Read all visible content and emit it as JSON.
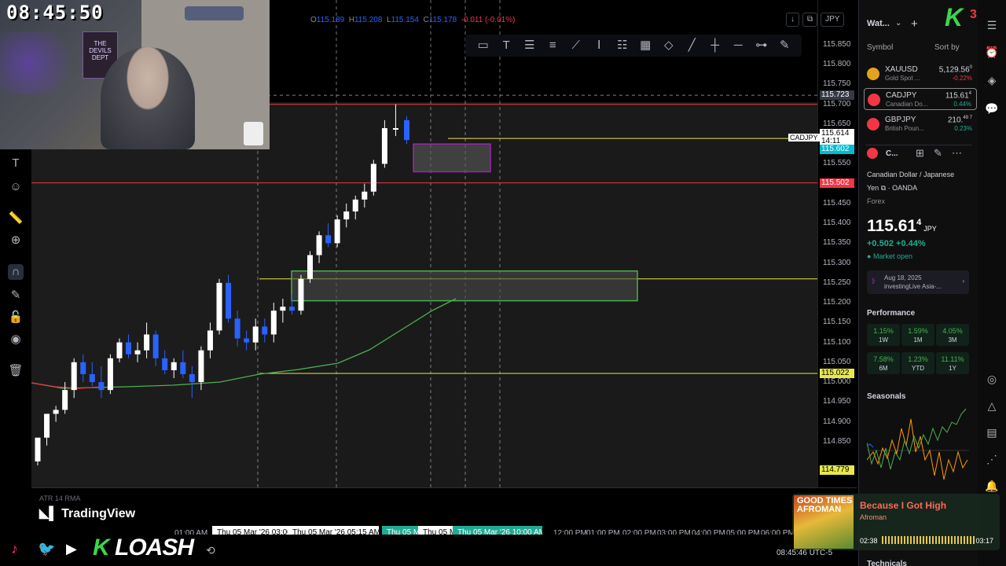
{
  "overlay": {
    "clock": "08:45:50",
    "poster_text": "THE DEVILS DEPT"
  },
  "chart": {
    "symbol": "CADJPY",
    "ohlc": {
      "o_label": "O",
      "o": "115.189",
      "h_label": "H",
      "h": "115.208",
      "l_label": "L",
      "l": "115.154",
      "c_label": "C",
      "c": "115.178",
      "change": "-0.011 (-0.01%)"
    },
    "currency_button": "JPY",
    "price_ticks": [
      "115.850",
      "115.800",
      "115.750",
      "115.700",
      "115.650",
      "115.600",
      "115.550",
      "115.450",
      "115.400",
      "115.350",
      "115.300",
      "115.250",
      "115.200",
      "115.150",
      "115.100",
      "115.050",
      "115.000",
      "114.950",
      "114.900",
      "114.850"
    ],
    "price_tags": {
      "crosshair": "115.723",
      "symbol_tag": "CADJPY",
      "last": "115.614",
      "countdown": "14:11",
      "bid": "115.602",
      "red_line": "115.502",
      "yellow_line": "115.022",
      "bottom": "114.779"
    },
    "atr_label": "ATR 14 RMA",
    "brand": "TradingView",
    "time_labels": [
      "01:00 AM",
      "12:00 PM",
      "01:00 PM",
      "02:00 PM",
      "03:00 PM",
      "04:00 PM",
      "05:00 PM",
      "06:00 PM"
    ],
    "time_pills": [
      {
        "text": "Thu 05 Mar '26   03:00",
        "color": "#ffffff",
        "bg": "#ffffff"
      },
      {
        "text": "Thu 05 Mar '26   05:15 AM",
        "color": "#ffffff",
        "bg": "#ffffff"
      },
      {
        "text": "Thu 05 M",
        "color": "#22ab94",
        "bg": "#22ab94"
      },
      {
        "text": "Thu 05 M",
        "color": "#ffffff",
        "bg": "#ffffff"
      },
      {
        "text": "Thu 05 Mar '26   10:00 AM",
        "color": "#22ab94",
        "bg": "#22ab94"
      }
    ],
    "colors": {
      "up": "#ffffff",
      "down": "#2962ff",
      "ma": "#4caf50",
      "ma_red": "#f23645",
      "zone_green": "#4caf50",
      "zone_purple": "#9c27b0",
      "level_yellow": "#e8e84a",
      "level_red": "#f23645"
    }
  },
  "left_tools": [
    "crosshair-icon",
    "text-icon",
    "smile-icon",
    "ruler-icon",
    "zoom-icon",
    "magnet-icon",
    "pencil-icon",
    "lock-icon",
    "eye-icon",
    "trash-icon"
  ],
  "draw_tools": [
    "rectangle-icon",
    "text-icon",
    "fib-icon",
    "levels-icon",
    "brush-icon",
    "text-cursor-icon",
    "lines-icon",
    "grid-icon",
    "shape-icon",
    "trendline-icon",
    "vertical-line-icon",
    "horizontal-line-icon",
    "ray-icon",
    "pen-icon"
  ],
  "watchlist": {
    "title": "Wat...",
    "col_symbol": "Symbol",
    "col_sort": "Sort by",
    "rows": [
      {
        "sym": "XAUUSD",
        "desc": "Gold Spot ...",
        "price": "5,129.56",
        "sup": "0",
        "chg": "-0.22%",
        "chg_color": "#f23645",
        "icon_color": "#e5a21b"
      },
      {
        "sym": "CADJPY",
        "desc": "Canadian Do...",
        "price": "115.61",
        "sup": "4",
        "chg": "0.44%",
        "chg_color": "#22ab94",
        "icon_color": "#f23645"
      },
      {
        "sym": "GBPJPY",
        "desc": "British Poun...",
        "price": "210.",
        "sup": "49 7",
        "chg": "0.23%",
        "chg_color": "#22ab94",
        "icon_color": "#f23645"
      }
    ]
  },
  "details": {
    "short_symbol": "C...",
    "name": "Canadian Dollar / Japanese",
    "name2": "Yen",
    "exchange": "OANDA",
    "type": "Forex",
    "price": "115.61",
    "price_sup": "4",
    "currency": "JPY",
    "change": "+0.502",
    "change_pct": "+0.44%",
    "status": "Market open",
    "news_date": "Aug 18, 2025",
    "news_source": "investingLive Asia-...",
    "performance_title": "Performance",
    "performance": [
      {
        "value": "1.15%",
        "label": "1W"
      },
      {
        "value": "1.59%",
        "label": "1M"
      },
      {
        "value": "4.05%",
        "label": "3M"
      },
      {
        "value": "7.58%",
        "label": "6M"
      },
      {
        "value": "1.23%",
        "label": "YTD"
      },
      {
        "value": "11.11%",
        "label": "1Y"
      }
    ],
    "seasonals_title": "Seasonals",
    "technicals_title": "Technicals"
  },
  "far_right_icons": [
    "watchlist-icon",
    "alarm-icon",
    "layers-icon",
    "chat-icon",
    "target-icon",
    "triangle-icon",
    "calendar-icon",
    "signal-icon",
    "bell-icon"
  ],
  "music": {
    "album_text": "GOOD TIMES AFROMAN",
    "title": "Because I Got High",
    "artist": "Afroman",
    "elapsed": "02:38",
    "duration": "03:17"
  },
  "social": {
    "name": "LOASH",
    "k_letter": "K",
    "badge": "3"
  },
  "status_bar": {
    "time": "08:45:46 UTC-5"
  }
}
